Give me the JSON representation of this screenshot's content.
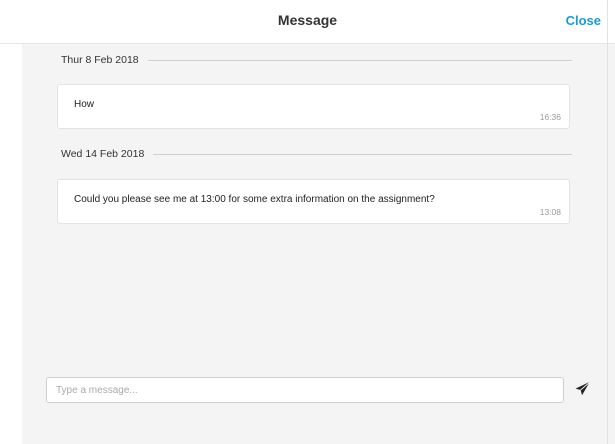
{
  "header": {
    "title": "Message",
    "close_label": "Close"
  },
  "thread": {
    "groups": [
      {
        "date": "Thur 8 Feb 2018",
        "messages": [
          {
            "text": "How",
            "time": "16:36"
          }
        ]
      },
      {
        "date": "Wed 14 Feb 2018",
        "messages": [
          {
            "text": "Could you please see me at 13:00 for some extra information on the assignment?",
            "time": "13:08"
          }
        ]
      }
    ]
  },
  "composer": {
    "placeholder": "Type a message...",
    "send_icon": "paper-plane-icon"
  },
  "colors": {
    "accent": "#1a9bd7",
    "background": "#f4f4f4"
  }
}
